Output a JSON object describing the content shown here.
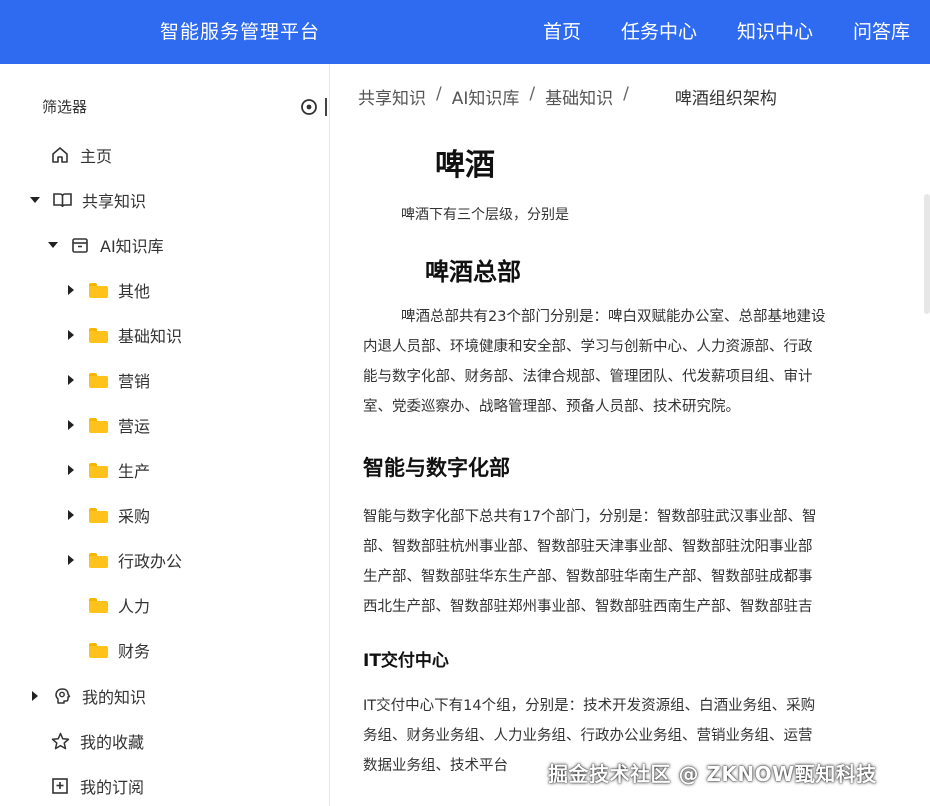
{
  "app": {
    "title": "智能服务管理平台"
  },
  "nav": [
    {
      "label": "首页"
    },
    {
      "label": "任务中心"
    },
    {
      "label": "知识中心"
    },
    {
      "label": "问答库"
    }
  ],
  "sidebar": {
    "filter_label": "筛选器",
    "items": [
      {
        "label": "主页",
        "icon": "home-icon"
      },
      {
        "label": "共享知识",
        "icon": "book-icon",
        "expanded": true
      },
      {
        "label": "AI知识库",
        "icon": "archive-box-icon",
        "expanded": true
      },
      {
        "label": "其他",
        "icon": "folder-icon"
      },
      {
        "label": "基础知识",
        "icon": "folder-icon"
      },
      {
        "label": "营销",
        "icon": "folder-icon"
      },
      {
        "label": "营运",
        "icon": "folder-icon"
      },
      {
        "label": "生产",
        "icon": "folder-icon"
      },
      {
        "label": "采购",
        "icon": "folder-icon"
      },
      {
        "label": "行政办公",
        "icon": "folder-icon"
      },
      {
        "label": "人力",
        "icon": "folder-icon"
      },
      {
        "label": "财务",
        "icon": "folder-icon"
      },
      {
        "label": "我的知识",
        "icon": "brain-icon"
      },
      {
        "label": "我的收藏",
        "icon": "star-icon"
      },
      {
        "label": "我的订阅",
        "icon": "subscribe-icon"
      }
    ]
  },
  "breadcrumb": {
    "items": [
      "共享知识",
      "AI知识库",
      "基础知识"
    ],
    "separator": "/",
    "current": "啤酒组织架构"
  },
  "article": {
    "title": "啤酒",
    "intro": "啤酒下有三个层级，分别是",
    "section1_title": "啤酒总部",
    "section1_lines": [
      "啤酒总部共有23个部门分别是：啤白双赋能办公室、总部基地建设",
      "内退人员部、环境健康和安全部、学习与创新中心、人力资源部、行政",
      "能与数字化部、财务部、法律合规部、管理团队、代发薪项目组、审计",
      "室、党委巡察办、战略管理部、预备人员部、技术研究院。"
    ],
    "section2_title": "智能与数字化部",
    "section2_lines": [
      "智能与数字化部下总共有17个部门，分别是：智数部驻武汉事业部、智",
      "部、智数部驻杭州事业部、智数部驻天津事业部、智数部驻沈阳事业部",
      "生产部、智数部驻华东生产部、智数部驻华南生产部、智数部驻成都事",
      "西北生产部、智数部驻郑州事业部、智数部驻西南生产部、智数部驻吉"
    ],
    "section3_title": "IT交付中心",
    "section3_lines": [
      "IT交付中心下有14个组，分别是：技术开发资源组、白酒业务组、采购",
      "务组、财务业务组、人力业务组、行政办公业务组、营销业务组、运营",
      "数据业务组、技术平台"
    ]
  },
  "watermark": "掘金技术社区 @ ZKNOW甄知科技",
  "colors": {
    "header_bg": "#2f6bf0",
    "folder": "#ffc21a"
  }
}
